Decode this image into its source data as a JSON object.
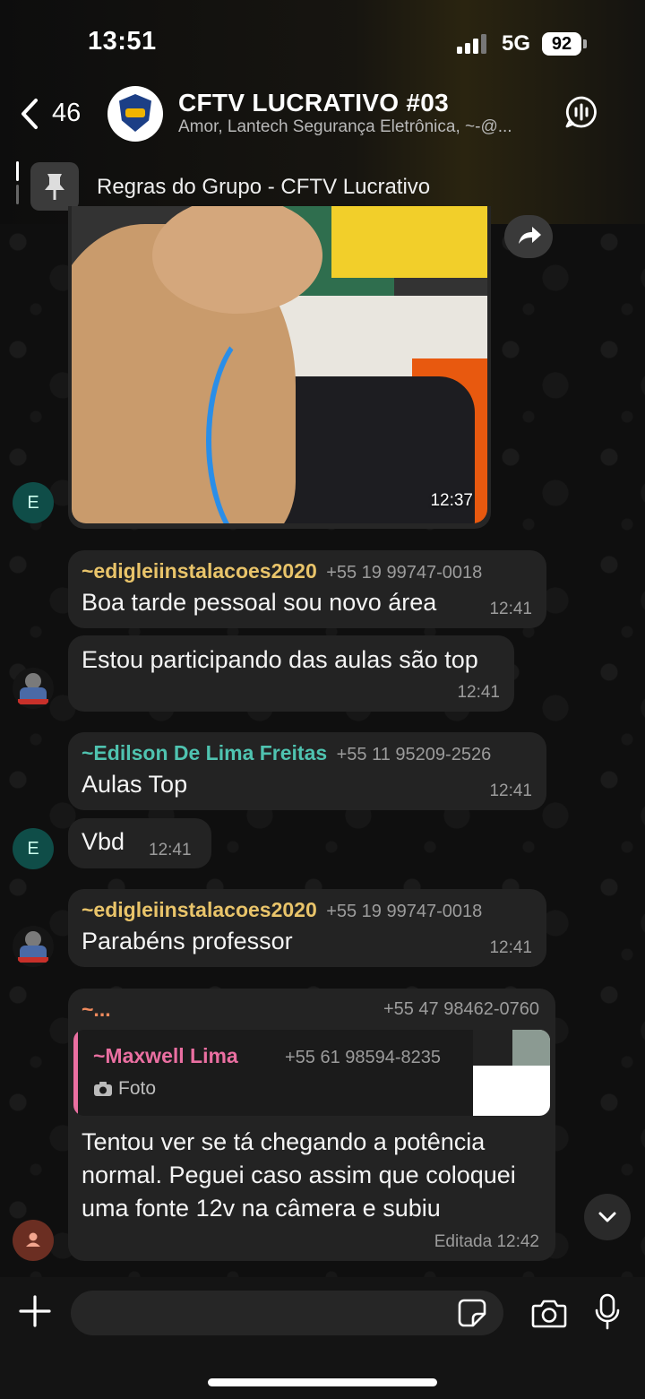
{
  "status_bar": {
    "time": "13:51",
    "network": "5G",
    "battery": "92"
  },
  "header": {
    "back_count": "46",
    "title": "CFTV LUCRATIVO #03",
    "subtitle": "Amor, Lantech Segurança Eletrônica, ~-@...",
    "pinned_text": "Regras do Grupo - CFTV Lucrativo"
  },
  "messages": [
    {
      "type": "photo",
      "time": "12:37",
      "avatar": "E"
    },
    {
      "sender": "~edigleiinstalacoes2020",
      "phone": "+55 19 99747-0018",
      "text": "Boa tarde pessoal sou novo área",
      "time": "12:41",
      "sender_color": "#e9c46a"
    },
    {
      "text": "Estou participando das aulas são top",
      "time": "12:41"
    },
    {
      "sender": "~Edilson De Lima Freitas",
      "phone": "+55 11 95209-2526",
      "text": "Aulas Top",
      "time": "12:41",
      "sender_color": "#4fc3b0"
    },
    {
      "text": "Vbd",
      "time": "12:41",
      "avatar": "E"
    },
    {
      "sender": "~edigleiinstalacoes2020",
      "phone": "+55 19 99747-0018",
      "text": "Parabéns professor",
      "time": "12:41",
      "sender_color": "#e9c46a"
    },
    {
      "sender": "~...",
      "phone": "+55 47 98462-0760",
      "sender_color": "#f08a5d",
      "quote": {
        "sender": "~Maxwell Lima",
        "phone": "+55 61 98594-8235",
        "label": "Foto",
        "color": "#ea6fa1"
      },
      "text_lines": [
        "Tentou ver se tá chegando a potência",
        "normal. Peguei caso assim que coloquei",
        "uma fonte 12v na câmera e subiu"
      ],
      "time": "Editada 12:42"
    }
  ],
  "icons": [
    "back-chevron-icon",
    "voice-chat-icon",
    "pin-icon",
    "share-icon",
    "chevron-down-icon",
    "plus-icon",
    "sticker-icon",
    "camera-icon",
    "mic-icon",
    "person-icon"
  ]
}
